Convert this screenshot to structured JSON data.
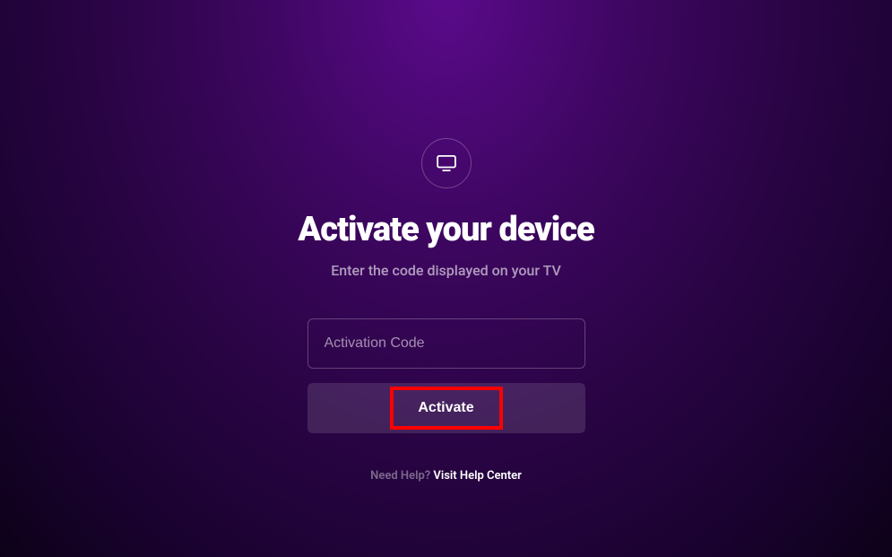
{
  "title": "Activate your device",
  "subtitle": "Enter the code displayed on your TV",
  "input": {
    "placeholder": "Activation Code",
    "value": ""
  },
  "button": {
    "label": "Activate"
  },
  "help": {
    "prompt": "Need Help? ",
    "link_text": "Visit Help Center"
  }
}
